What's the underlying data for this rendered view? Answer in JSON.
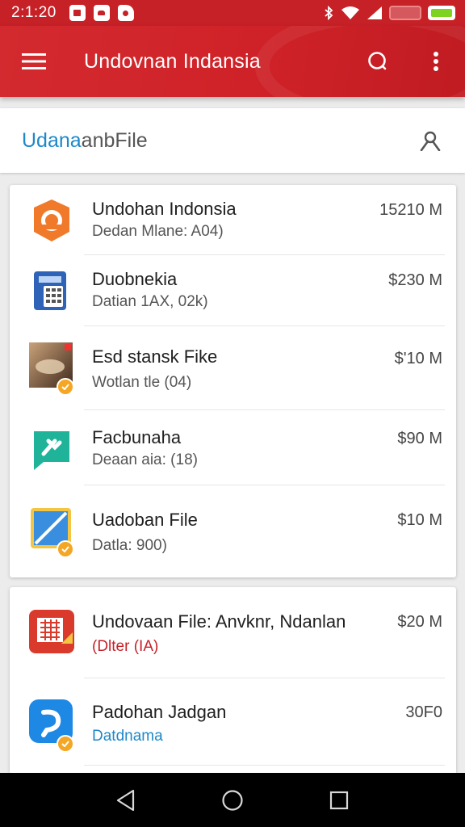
{
  "status_bar": {
    "time": "2:1:20",
    "notifications": [
      "notification-icon",
      "notification-icon",
      "notification-icon"
    ],
    "icons": [
      "bluetooth-icon",
      "wifi-icon",
      "signal-icon",
      "battery-icon"
    ]
  },
  "app_bar": {
    "title": "Undovnan Indansia",
    "menu_icon": "menu-icon",
    "search_icon": "search-icon",
    "more_icon": "more-vert-icon"
  },
  "search": {
    "text_blue": "Udana",
    "text_rest": "anbFile",
    "filter_icon": "filter-icon"
  },
  "list": [
    {
      "title": "Undohan Indonsia",
      "subtitle": "Dedan Mlane: A04)",
      "size": "15210 M",
      "icon": "orange-app-icon",
      "color": "#f07a2a",
      "checked": false
    },
    {
      "title": "Duobnekia",
      "subtitle": "Datian 1AX, 02k)",
      "size": "$230 M",
      "icon": "calculator-app-icon",
      "color": "#2e63b8",
      "checked": false
    },
    {
      "title": "Esd stansk Fike",
      "subtitle": "Wotlan tle (04)",
      "size": "$'10 M",
      "icon": "photo-app-icon",
      "color": "#8a5a3a",
      "checked": true
    },
    {
      "title": "Facbunaha",
      "subtitle": "Deaan aia: (18)",
      "size": "$90 M",
      "icon": "chat-app-icon",
      "color": "#1fb39a",
      "checked": false
    },
    {
      "title": "Uadoban File",
      "subtitle": "Datla: 900)",
      "size": "$10 M",
      "icon": "map-app-icon",
      "color": "#3a8ee0",
      "checked": true
    }
  ],
  "list2": [
    {
      "title": "Undovaan File: Anvknr, Ndanlan",
      "subtitle": "(Dlter (IA)",
      "size": "$20 M",
      "icon": "grid-app-icon",
      "color": "#d93a2b",
      "subcolor": "#c62127",
      "checked": false
    },
    {
      "title": "Padohan Jadgan",
      "subtitle": "Datdnama",
      "size": "30F0",
      "icon": "chat-bubble-app-icon",
      "color": "#1e88e5",
      "subcolor": "#1e88c9",
      "checked": true
    }
  ],
  "nav": {
    "back_icon": "back-icon",
    "home_icon": "home-icon",
    "recents_icon": "recents-icon"
  }
}
